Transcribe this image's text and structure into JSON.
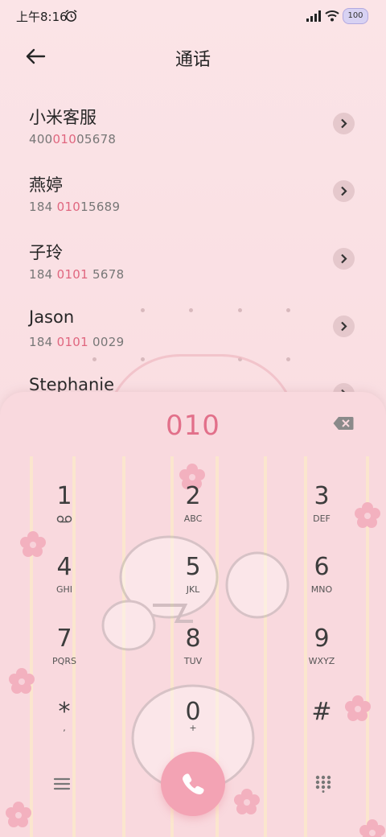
{
  "status_bar": {
    "time": "上午8:16",
    "battery": "100"
  },
  "header": {
    "title": "通话"
  },
  "contacts": [
    {
      "name": "小米客服",
      "num_pre": "400",
      "num_hl": "010",
      "num_post": "05678"
    },
    {
      "name": "燕婷",
      "num_pre": "184 ",
      "num_hl": "010",
      "num_post": "15689"
    },
    {
      "name": "子玲",
      "num_pre": "184 ",
      "num_hl": "0101",
      "num_post": " 5678"
    },
    {
      "name": "Jason",
      "num_pre": "184 ",
      "num_hl": "0101",
      "num_post": " 0029"
    },
    {
      "name": "Stephanie",
      "num_pre": "",
      "num_hl": "",
      "num_post": ""
    }
  ],
  "dialpad": {
    "input": "010",
    "keys": [
      {
        "digit": "1",
        "letters": ""
      },
      {
        "digit": "2",
        "letters": "ABC"
      },
      {
        "digit": "3",
        "letters": "DEF"
      },
      {
        "digit": "4",
        "letters": "GHI"
      },
      {
        "digit": "5",
        "letters": "JKL"
      },
      {
        "digit": "6",
        "letters": "MNO"
      },
      {
        "digit": "7",
        "letters": "PQRS"
      },
      {
        "digit": "8",
        "letters": "TUV"
      },
      {
        "digit": "9",
        "letters": "WXYZ"
      },
      {
        "digit": "*",
        "letters": ","
      },
      {
        "digit": "0",
        "letters": "+"
      },
      {
        "digit": "#",
        "letters": ""
      }
    ]
  },
  "colors": {
    "accent": "#e2708a",
    "call_button": "#f3a3b4",
    "background": "#fbe3e6"
  },
  "icons": {
    "back": "arrow-left-icon",
    "detail": "chevron-right-icon",
    "backspace": "backspace-icon",
    "voicemail": "voicemail-icon",
    "menu": "menu-icon",
    "call": "phone-icon",
    "keypad": "dialpad-icon"
  }
}
